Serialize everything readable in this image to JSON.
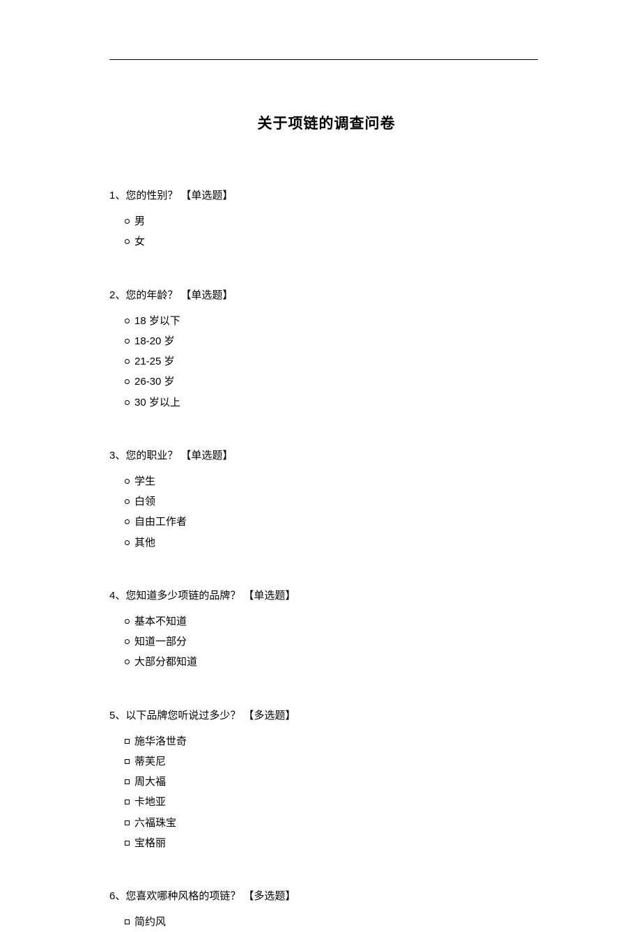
{
  "title": "关于项链的调查问卷",
  "questions": [
    {
      "number": "1、",
      "text": "您的性别？",
      "type": "【单选题】",
      "bullet": "circle",
      "options": [
        "男",
        "女"
      ]
    },
    {
      "number": "2、",
      "text": "您的年龄？",
      "type": "【单选题】",
      "bullet": "circle",
      "options": [
        "18 岁以下",
        "18-20 岁",
        "21-25 岁",
        "26-30 岁",
        "30 岁以上"
      ]
    },
    {
      "number": "3、",
      "text": "您的职业？",
      "type": "【单选题】",
      "bullet": "circle",
      "options": [
        "学生",
        "白领",
        "自由工作者",
        "其他"
      ]
    },
    {
      "number": "4、",
      "text": "您知道多少项链的品牌？",
      "type": "【单选题】",
      "bullet": "circle",
      "options": [
        "基本不知道",
        "知道一部分",
        "大部分都知道"
      ]
    },
    {
      "number": "5、",
      "text": "以下品牌您听说过多少？",
      "type": "【多选题】",
      "bullet": "square",
      "options": [
        "施华洛世奇",
        "蒂芙尼",
        "周大福",
        "卡地亚",
        "六福珠宝",
        "宝格丽"
      ]
    },
    {
      "number": "6、",
      "text": "您喜欢哪种风格的项链？",
      "type": "【多选题】",
      "bullet": "square",
      "options": [
        "简约风"
      ]
    }
  ]
}
